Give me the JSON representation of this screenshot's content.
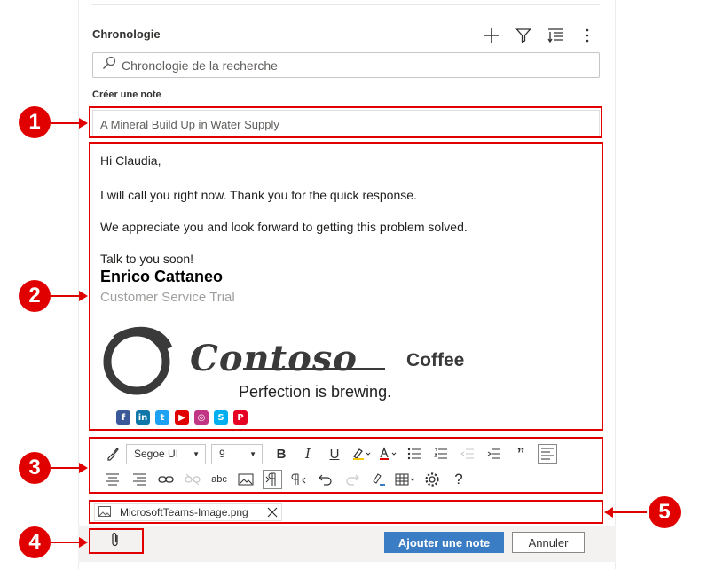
{
  "timeline": {
    "title": "Chronologie",
    "search_placeholder": "Chronologie de la recherche",
    "actions": [
      "plus-icon",
      "filter-icon",
      "sort-icon",
      "more-icon"
    ]
  },
  "note": {
    "label": "Créer une note",
    "title_value": "A Mineral Build Up in Water Supply",
    "body_lines": [
      "Hi Claudia,",
      "I will call you right now. Thank you for the quick response.",
      "We appreciate you and look forward to getting this problem solved.",
      "Talk to you soon!"
    ],
    "signature_name": "Enrico Cattaneo",
    "signature_role": "Customer Service Trial",
    "logo_word": "Contoso",
    "logo_coffee": "Coffee",
    "logo_tagline": "Perfection is brewing.",
    "socials": [
      {
        "icon": "facebook-icon",
        "glyph": "f",
        "color": "#3b5998"
      },
      {
        "icon": "linkedin-icon",
        "glyph": "in",
        "color": "#0e76a8"
      },
      {
        "icon": "twitter-icon",
        "glyph": "t",
        "color": "#1da1f2"
      },
      {
        "icon": "youtube-icon",
        "glyph": "▶",
        "color": "#e00000"
      },
      {
        "icon": "instagram-icon",
        "glyph": "◎",
        "color": "#c13584"
      },
      {
        "icon": "skype-icon",
        "glyph": "S",
        "color": "#00aff0"
      },
      {
        "icon": "pinterest-icon",
        "glyph": "P",
        "color": "#e60023"
      }
    ]
  },
  "toolbar": {
    "font_family": "Segoe UI",
    "font_size": "9"
  },
  "attachment": {
    "filename": "MicrosoftTeams-Image.png"
  },
  "footer": {
    "add_label": "Ajouter une note",
    "cancel_label": "Annuler"
  },
  "annotations": [
    "1",
    "2",
    "3",
    "4",
    "5"
  ],
  "colors": {
    "accent": "#3b7dc4",
    "callout": "#e00000"
  }
}
